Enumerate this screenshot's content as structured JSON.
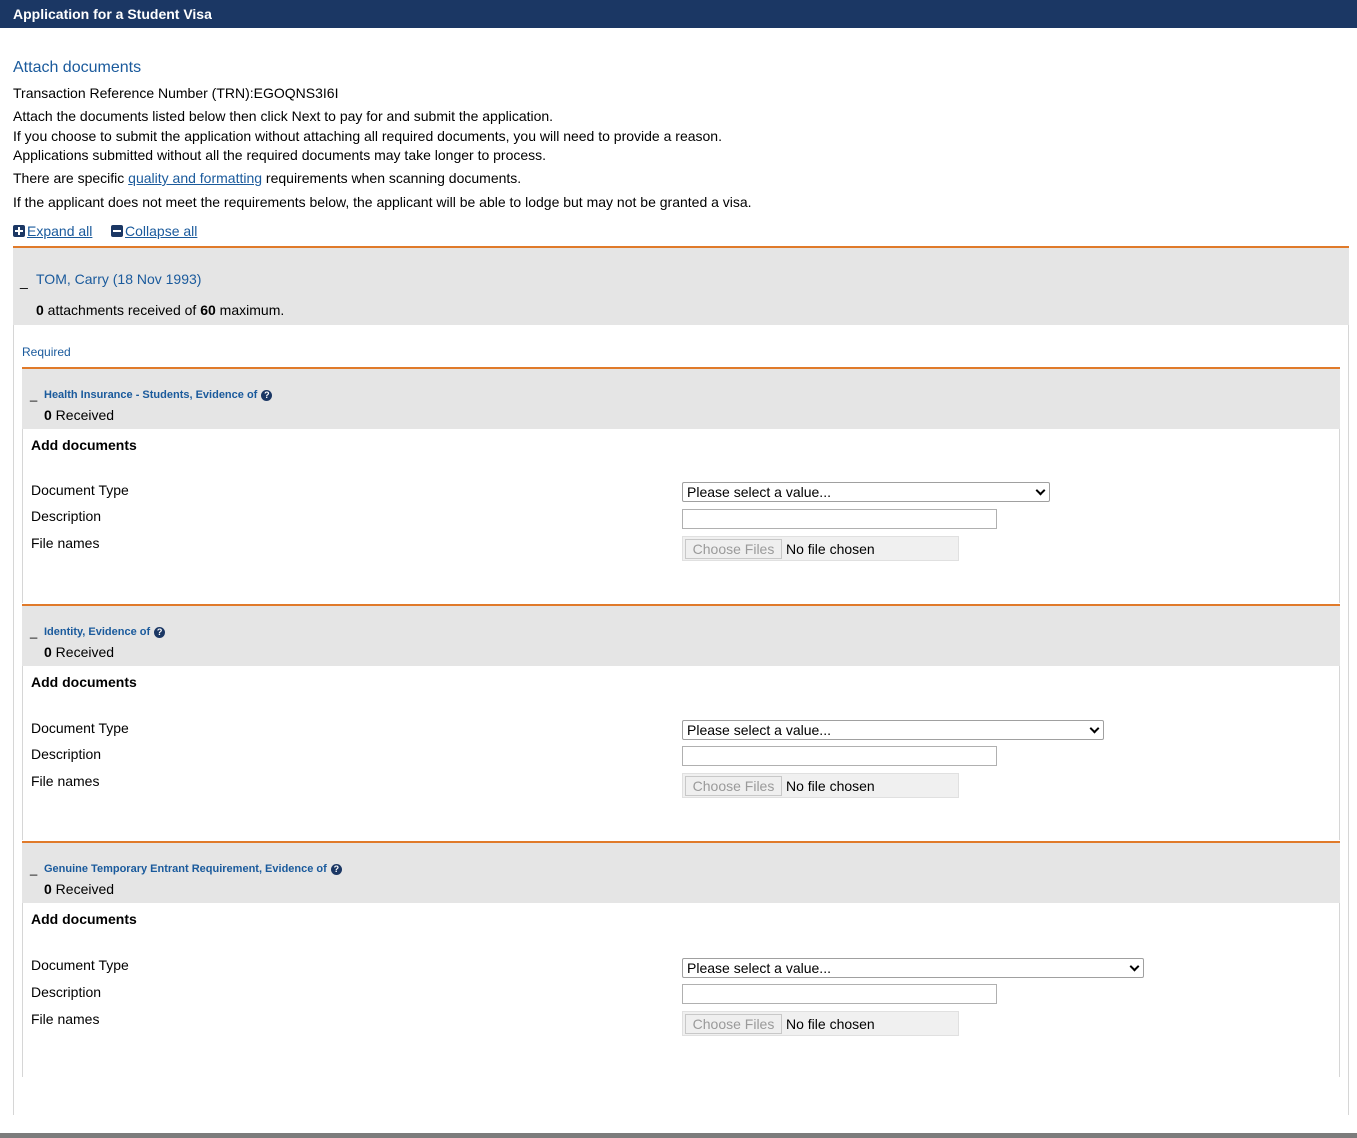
{
  "window": {
    "title": "Application for a Student Visa"
  },
  "page": {
    "heading": "Attach documents",
    "trn_text": "Transaction Reference Number (TRN):EGOQNS3I6I",
    "instructions": [
      "Attach the documents listed below then click Next to pay for and submit the application.",
      "If you choose to submit the application without attaching all required documents, you will need to provide a reason.",
      "Applications submitted without all the required documents may take longer to process."
    ],
    "quality_prefix": "There are specific ",
    "quality_link": "quality and formatting",
    "quality_suffix": " requirements when scanning documents.",
    "warning": "If the applicant does not meet the requirements below, the applicant will be able to lodge but may not be granted a visa.",
    "expand_all": "Expand all",
    "collapse_all": "Collapse all"
  },
  "applicant": {
    "toggle": "_",
    "name": "TOM, Carry (18 Nov 1993)",
    "attachments_received": "0",
    "attachments_mid": " attachments received of ",
    "attachments_max": "60",
    "attachments_suffix": " maximum."
  },
  "required_label": "Required",
  "sections": [
    {
      "toggle": "_",
      "title": "Health Insurance - Students, Evidence of",
      "received_count": "0",
      "received_label": " Received",
      "add_docs": "Add documents",
      "doc_type_label": "Document Type",
      "doc_type_value": "Please select a value...",
      "description_label": "Description",
      "description_value": "",
      "file_label": "File names",
      "file_button": "Choose Files",
      "file_status": "No file chosen"
    },
    {
      "toggle": "_",
      "title": "Identity, Evidence of",
      "received_count": "0",
      "received_label": " Received",
      "add_docs": "Add documents",
      "doc_type_label": "Document Type",
      "doc_type_value": "Please select a value...",
      "description_label": "Description",
      "description_value": "",
      "file_label": "File names",
      "file_button": "Choose Files",
      "file_status": "No file chosen"
    },
    {
      "toggle": "_",
      "title": "Genuine Temporary Entrant Requirement, Evidence of",
      "received_count": "0",
      "received_label": " Received",
      "add_docs": "Add documents",
      "doc_type_label": "Document Type",
      "doc_type_value": "Please select a value...",
      "description_label": "Description",
      "description_value": "",
      "file_label": "File names",
      "file_button": "Choose Files",
      "file_status": "No file chosen"
    }
  ],
  "icons": {
    "help": "question-circle-icon",
    "expand": "plus-square-icon",
    "collapse": "minus-square-icon",
    "dropdown": "chevron-down-icon"
  },
  "colors": {
    "title_bar": "#1b3764",
    "link": "#1a5a9c",
    "accent_line": "#e07a2a",
    "panel_bg": "#e5e5e5"
  }
}
